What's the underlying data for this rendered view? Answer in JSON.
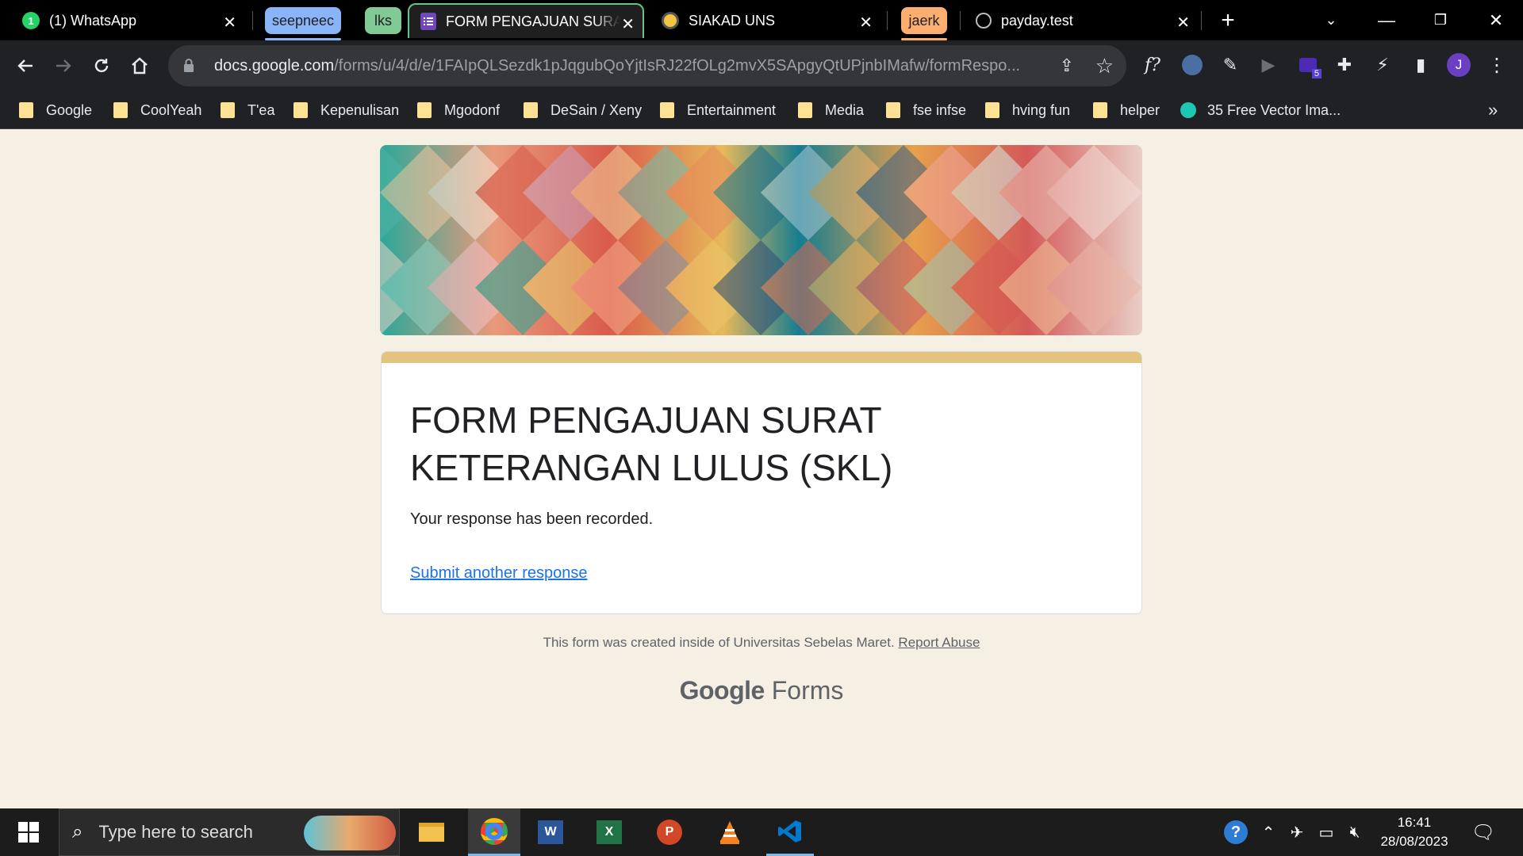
{
  "tabs": [
    {
      "title": "(1) WhatsApp",
      "icon": "whatsapp-icon"
    },
    {
      "group": "seepneec",
      "color": "#8ab4f8"
    },
    {
      "group": "lks",
      "color": "#81c995"
    },
    {
      "title": "FORM PENGAJUAN SURAT",
      "icon": "google-forms-icon",
      "active": true
    },
    {
      "title": "SIAKAD UNS",
      "icon": "siakad-icon"
    },
    {
      "group": "jaerk",
      "color": "#fcad70"
    },
    {
      "title": "payday.test",
      "icon": "globe-icon"
    }
  ],
  "window_controls": {
    "new_tab": "+",
    "minimize": "—",
    "restore": "❐",
    "close": "✕"
  },
  "address_bar": {
    "domain": "docs.google.com",
    "path": "/forms/u/4/d/e/1FAIpQLSezdk1pJqgubQoYjtIsRJ22fOLg2mvX5SApgyQtUPjnbIMafw/formRespo..."
  },
  "extensions_badge": "5",
  "profile_initial": "J",
  "bookmarks": [
    "Google",
    "CoolYeah",
    "T'ea",
    "Kepenulisan",
    "Mgodonf",
    "DeSain / Xeny",
    "Entertainment",
    "Media",
    "fse infse",
    "hving fun",
    "helper",
    "35 Free Vector Ima..."
  ],
  "bookmarks_more": "»",
  "form": {
    "title": "FORM PENGAJUAN SURAT KETERANGAN LULUS (SKL)",
    "confirmation": "Your response has been recorded.",
    "another_link": "Submit another response",
    "footer_text": "This form was created inside of Universitas Sebelas Maret.",
    "report_abuse": "Report Abuse",
    "brand_google": "Google",
    "brand_forms": "Forms",
    "accent_color": "#e2c47f",
    "background": "#f5efe4"
  },
  "taskbar": {
    "search_placeholder": "Type here to search",
    "apps": [
      "file-explorer-icon",
      "chrome-icon",
      "word-icon",
      "excel-icon",
      "powerpoint-icon",
      "vlc-icon",
      "vscode-icon"
    ],
    "time": "16:41",
    "date": "28/08/2023"
  }
}
